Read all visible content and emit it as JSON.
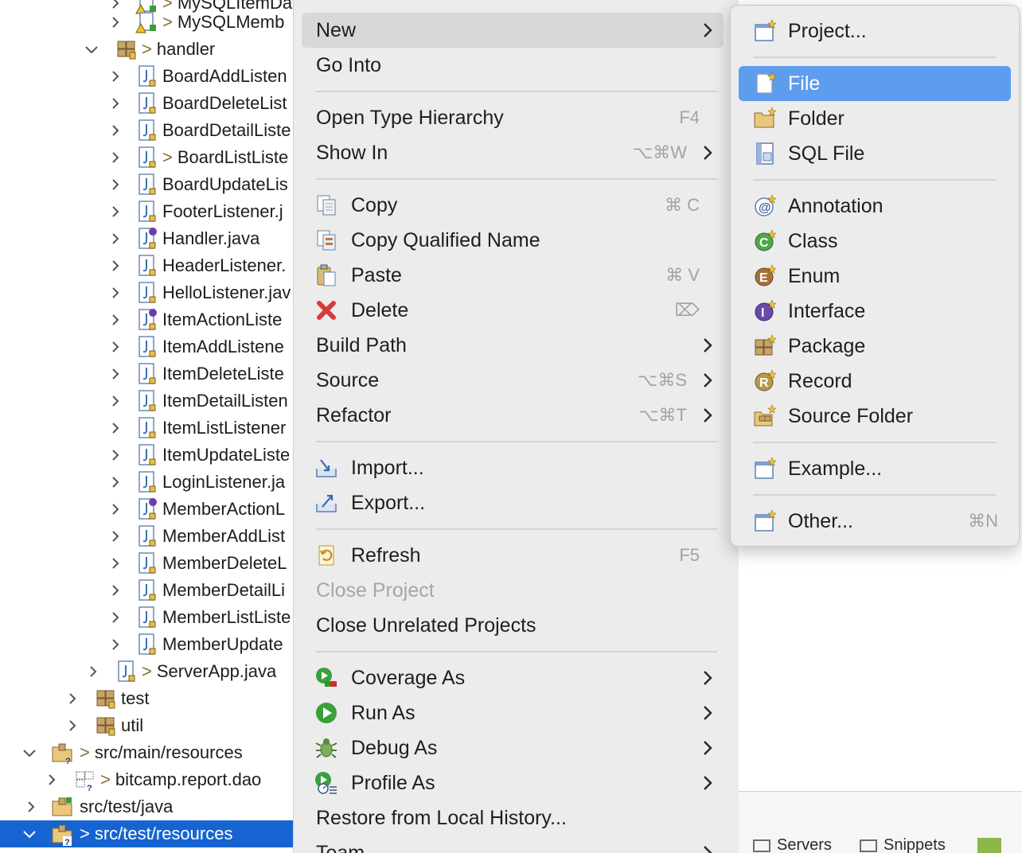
{
  "tree": {
    "items": [
      {
        "label": "MySQLItemDao.java",
        "prefix": ">",
        "icon": "java-file-warning-icon"
      },
      {
        "label": "MySQLMemb",
        "prefix": ">",
        "icon": "java-file-warning-icon"
      },
      {
        "label": "handler",
        "prefix": ">",
        "icon": "package-icon"
      },
      {
        "label": "BoardAddListen",
        "prefix": "",
        "icon": "java-file-icon"
      },
      {
        "label": "BoardDeleteList",
        "prefix": "",
        "icon": "java-file-icon"
      },
      {
        "label": "BoardDetailListe",
        "prefix": "",
        "icon": "java-file-icon"
      },
      {
        "label": "BoardListListe",
        "prefix": ">",
        "icon": "java-file-icon"
      },
      {
        "label": "BoardUpdateLis",
        "prefix": "",
        "icon": "java-file-icon"
      },
      {
        "label": "FooterListener.j",
        "prefix": "",
        "icon": "java-file-icon"
      },
      {
        "label": "Handler.java",
        "prefix": "",
        "icon": "java-interface-file-icon"
      },
      {
        "label": "HeaderListener.",
        "prefix": "",
        "icon": "java-file-icon"
      },
      {
        "label": "HelloListener.jav",
        "prefix": "",
        "icon": "java-file-icon"
      },
      {
        "label": "ItemActionListe",
        "prefix": "",
        "icon": "java-interface-file-icon"
      },
      {
        "label": "ItemAddListene",
        "prefix": "",
        "icon": "java-file-icon"
      },
      {
        "label": "ItemDeleteListe",
        "prefix": "",
        "icon": "java-file-icon"
      },
      {
        "label": "ItemDetailListen",
        "prefix": "",
        "icon": "java-file-icon"
      },
      {
        "label": "ItemListListener",
        "prefix": "",
        "icon": "java-file-icon"
      },
      {
        "label": "ItemUpdateListe",
        "prefix": "",
        "icon": "java-file-icon"
      },
      {
        "label": "LoginListener.ja",
        "prefix": "",
        "icon": "java-file-icon"
      },
      {
        "label": "MemberActionL",
        "prefix": "",
        "icon": "java-interface-file-icon"
      },
      {
        "label": "MemberAddList",
        "prefix": "",
        "icon": "java-file-icon"
      },
      {
        "label": "MemberDeleteL",
        "prefix": "",
        "icon": "java-file-icon"
      },
      {
        "label": "MemberDetailLi",
        "prefix": "",
        "icon": "java-file-icon"
      },
      {
        "label": "MemberListListe",
        "prefix": "",
        "icon": "java-file-icon"
      },
      {
        "label": "MemberUpdate",
        "prefix": "",
        "icon": "java-file-icon"
      },
      {
        "label": "ServerApp.java",
        "prefix": ">",
        "icon": "java-file-icon"
      },
      {
        "label": "test",
        "prefix": "",
        "icon": "package-icon"
      },
      {
        "label": "util",
        "prefix": "",
        "icon": "package-icon"
      },
      {
        "label": "src/main/resources",
        "prefix": ">",
        "icon": "source-folder-unknown-icon"
      },
      {
        "label": "bitcamp.report.dao",
        "prefix": ">",
        "icon": "empty-package-unknown-icon"
      },
      {
        "label": "src/test/java",
        "prefix": "",
        "icon": "source-folder-icon"
      },
      {
        "label": "src/test/resources",
        "prefix": ">",
        "icon": "source-folder-unknown-icon"
      }
    ]
  },
  "menu": {
    "items": [
      {
        "label": "New",
        "shortcut": "",
        "has_submenu": true,
        "icon": ""
      },
      {
        "label": "Go Into",
        "shortcut": "",
        "has_submenu": false,
        "icon": ""
      },
      {
        "label": "Open Type Hierarchy",
        "shortcut": "F4",
        "has_submenu": false,
        "icon": ""
      },
      {
        "label": "Show In",
        "shortcut": "⌥⌘W",
        "has_submenu": true,
        "icon": ""
      },
      {
        "label": "Copy",
        "shortcut": "⌘ C",
        "has_submenu": false,
        "icon": "copy-icon"
      },
      {
        "label": "Copy Qualified Name",
        "shortcut": "",
        "has_submenu": false,
        "icon": "copy-qualified-name-icon"
      },
      {
        "label": "Paste",
        "shortcut": "⌘ V",
        "has_submenu": false,
        "icon": "paste-icon"
      },
      {
        "label": "Delete",
        "shortcut": "⌦",
        "has_submenu": false,
        "icon": "delete-icon"
      },
      {
        "label": "Build Path",
        "shortcut": "",
        "has_submenu": true,
        "icon": ""
      },
      {
        "label": "Source",
        "shortcut": "⌥⌘S",
        "has_submenu": true,
        "icon": ""
      },
      {
        "label": "Refactor",
        "shortcut": "⌥⌘T",
        "has_submenu": true,
        "icon": ""
      },
      {
        "label": "Import...",
        "shortcut": "",
        "has_submenu": false,
        "icon": "import-icon"
      },
      {
        "label": "Export...",
        "shortcut": "",
        "has_submenu": false,
        "icon": "export-icon"
      },
      {
        "label": "Refresh",
        "shortcut": "F5",
        "has_submenu": false,
        "icon": "refresh-icon"
      },
      {
        "label": "Close Project",
        "shortcut": "",
        "has_submenu": false,
        "icon": ""
      },
      {
        "label": "Close Unrelated Projects",
        "shortcut": "",
        "has_submenu": false,
        "icon": ""
      },
      {
        "label": "Coverage As",
        "shortcut": "",
        "has_submenu": true,
        "icon": "coverage-icon"
      },
      {
        "label": "Run As",
        "shortcut": "",
        "has_submenu": true,
        "icon": "run-icon"
      },
      {
        "label": "Debug As",
        "shortcut": "",
        "has_submenu": true,
        "icon": "debug-bug-icon"
      },
      {
        "label": "Profile As",
        "shortcut": "",
        "has_submenu": true,
        "icon": "profile-icon"
      },
      {
        "label": "Restore from Local History...",
        "shortcut": "",
        "has_submenu": false,
        "icon": ""
      },
      {
        "label": "Team",
        "shortcut": "",
        "has_submenu": true,
        "icon": ""
      }
    ]
  },
  "submenu": {
    "items": [
      {
        "label": "Project...",
        "shortcut": "",
        "icon": "new-project-icon"
      },
      {
        "label": "File",
        "shortcut": "",
        "icon": "new-file-icon"
      },
      {
        "label": "Folder",
        "shortcut": "",
        "icon": "new-folder-icon"
      },
      {
        "label": "SQL File",
        "shortcut": "",
        "icon": "sql-file-icon"
      },
      {
        "label": "Annotation",
        "shortcut": "",
        "icon": "annotation-icon"
      },
      {
        "label": "Class",
        "shortcut": "",
        "icon": "class-icon"
      },
      {
        "label": "Enum",
        "shortcut": "",
        "icon": "enum-icon"
      },
      {
        "label": "Interface",
        "shortcut": "",
        "icon": "interface-icon"
      },
      {
        "label": "Package",
        "shortcut": "",
        "icon": "package-icon"
      },
      {
        "label": "Record",
        "shortcut": "",
        "icon": "record-icon"
      },
      {
        "label": "Source Folder",
        "shortcut": "",
        "icon": "source-folder-icon"
      },
      {
        "label": "Example...",
        "shortcut": "",
        "icon": "example-icon"
      },
      {
        "label": "Other...",
        "shortcut": "⌘N",
        "icon": "other-wizard-icon"
      }
    ]
  },
  "bottom_panel": {
    "tabs": [
      "Servers",
      "Snippets"
    ]
  },
  "colors": {
    "selection": "#1664d2",
    "submenu_highlight": "#5e9cee",
    "menu_bg": "#ececec",
    "menu_hover": "#d8d8d8"
  }
}
